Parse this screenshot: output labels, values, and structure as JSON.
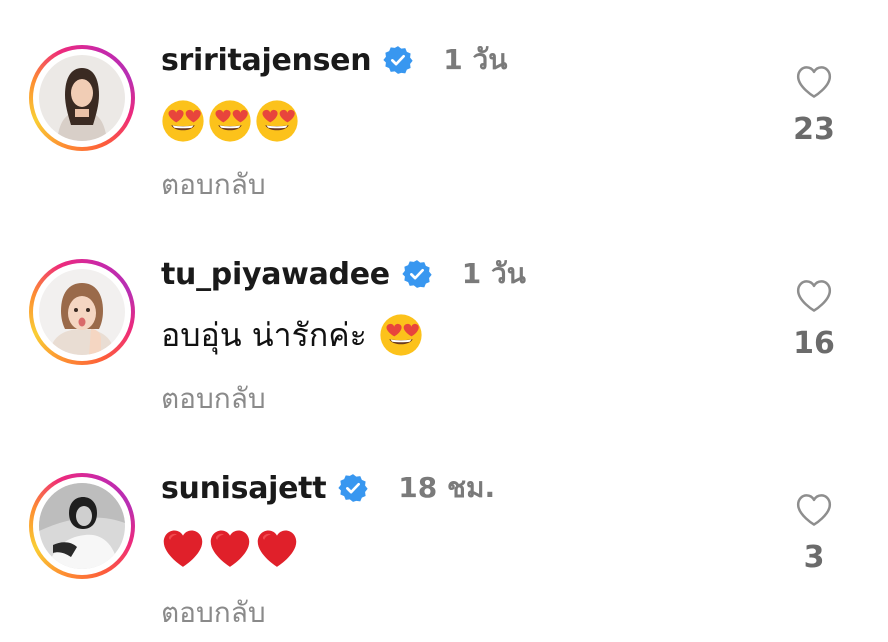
{
  "comments": [
    {
      "username": "sriritajensen",
      "time": "1 วัน",
      "text": "",
      "emojis": [
        "heart-eyes",
        "heart-eyes",
        "heart-eyes"
      ],
      "reply_label": "ตอบกลับ",
      "likes": "23",
      "verified": true
    },
    {
      "username": "tu_piyawadee",
      "time": "1 วัน",
      "text": "อบอุ่น น่ารักค่ะ",
      "emojis": [
        "heart-eyes"
      ],
      "reply_label": "ตอบกลับ",
      "likes": "16",
      "verified": true
    },
    {
      "username": "sunisajett",
      "time": "18 ชม.",
      "text": "",
      "emojis": [
        "red-heart",
        "red-heart",
        "red-heart"
      ],
      "reply_label": "ตอบกลับ",
      "likes": "3",
      "verified": true
    }
  ],
  "colors": {
    "verified_blue": "#3897f0",
    "muted_text": "#8a8a8a",
    "heart_red": "#e0202a",
    "emoji_yellow": "#fcc21b"
  }
}
